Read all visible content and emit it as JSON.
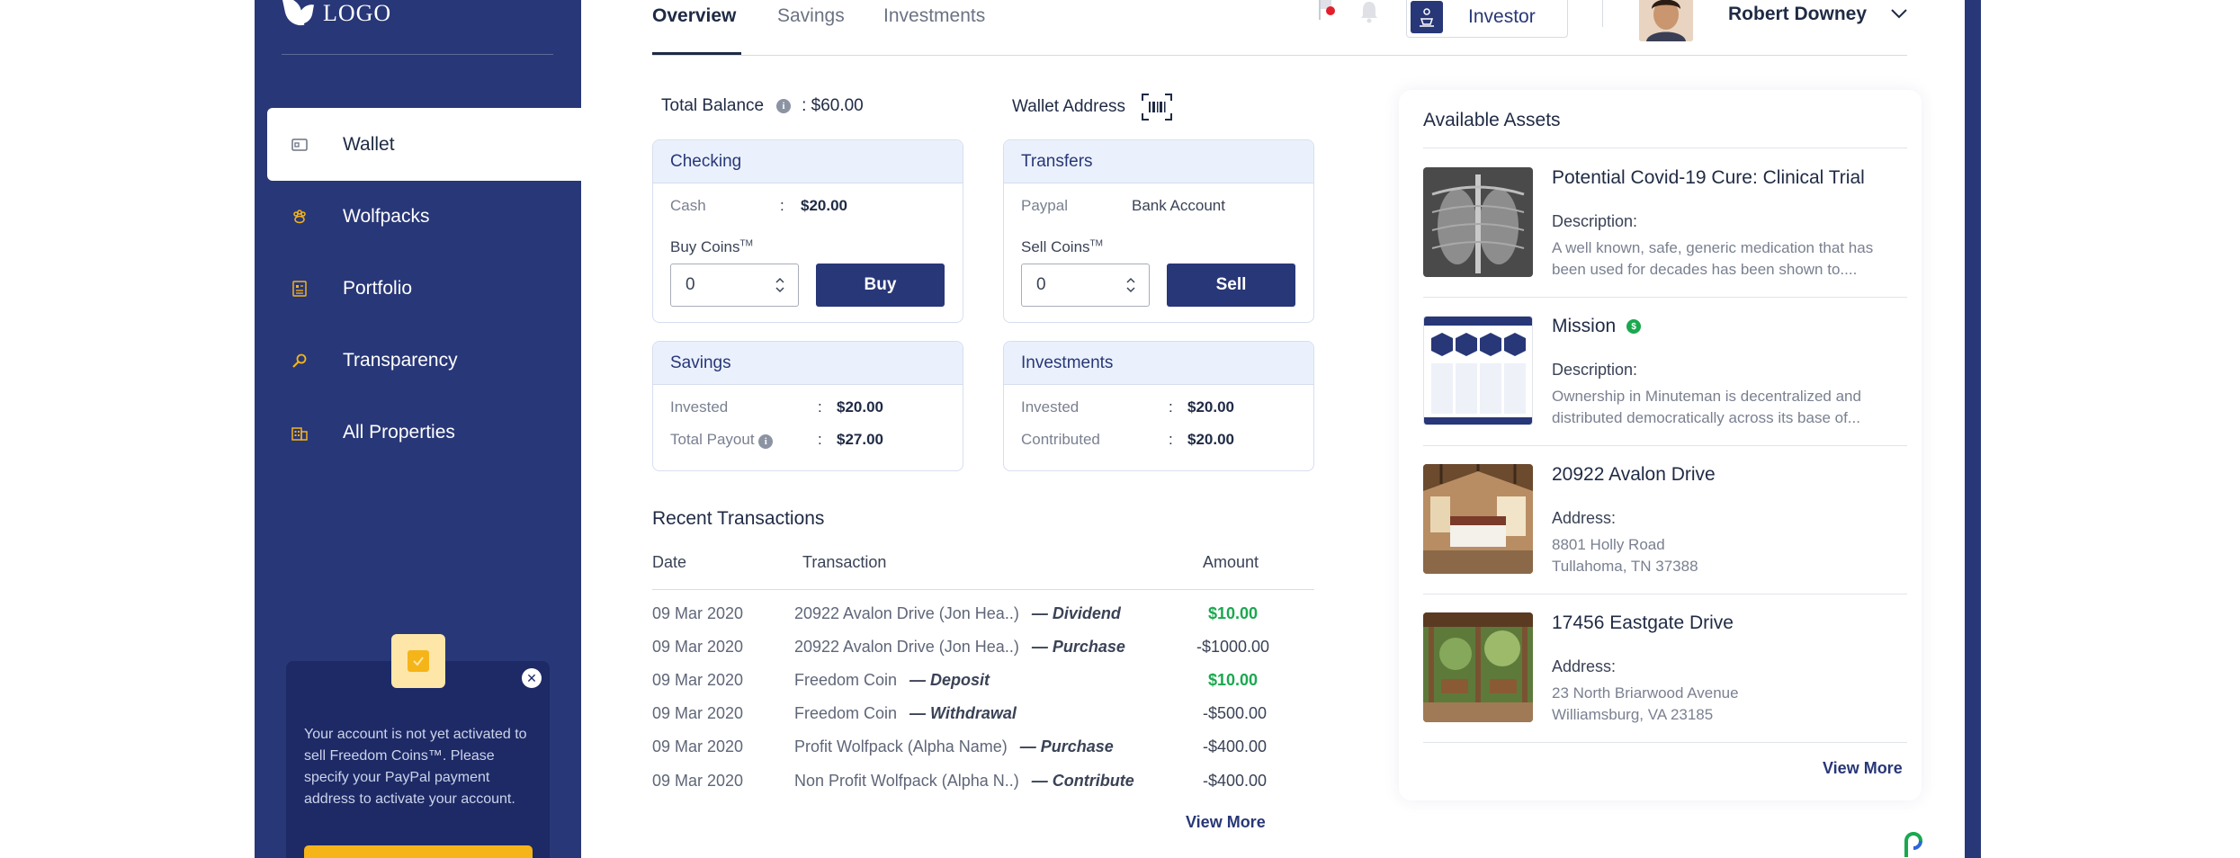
{
  "sidebar": {
    "logo_text": "LOGO",
    "items": [
      {
        "label": "Wallet"
      },
      {
        "label": "Wolfpacks"
      },
      {
        "label": "Portfolio"
      },
      {
        "label": "Transparency"
      },
      {
        "label": "All Properties"
      }
    ],
    "popup": {
      "text": "Your account is not yet activated to sell Freedom Coins™. Please specify your PayPal payment address to activate your account.",
      "close_icon": "close-icon"
    }
  },
  "tabs": [
    "Overview",
    "Savings",
    "Investments"
  ],
  "header": {
    "role_label": "Investor",
    "user_name": "Robert Downey"
  },
  "balance": {
    "label": "Total Balance",
    "value": ": $60.00",
    "wallet_label": "Wallet Address"
  },
  "checking": {
    "title": "Checking",
    "cash_label": "Cash",
    "cash_value": "$20.00",
    "buy_label": "Buy Coins",
    "tm": "TM",
    "input_value": "0",
    "button": "Buy"
  },
  "transfers": {
    "title": "Transfers",
    "paypal": "Paypal",
    "bank": "Bank Account",
    "sell_label": "Sell Coins",
    "tm": "TM",
    "input_value": "0",
    "button": "Sell"
  },
  "savings": {
    "title": "Savings",
    "invested_label": "Invested",
    "invested_value": "$20.00",
    "payout_label": "Total Payout",
    "payout_value": "$27.00"
  },
  "investments": {
    "title": "Investments",
    "invested_label": "Invested",
    "invested_value": "$20.00",
    "contributed_label": "Contributed",
    "contributed_value": "$20.00"
  },
  "transactions": {
    "title": "Recent Transactions",
    "headers": {
      "date": "Date",
      "transaction": "Transaction",
      "amount": "Amount"
    },
    "rows": [
      {
        "date": "09 Mar 2020",
        "name": "20922 Avalon Drive  (Jon Hea..)",
        "type": "— Dividend",
        "amount": "$10.00",
        "positive": true
      },
      {
        "date": "09 Mar 2020",
        "name": "20922 Avalon Drive  (Jon Hea..)",
        "type": "— Purchase",
        "amount": "-$1000.00",
        "positive": false
      },
      {
        "date": "09 Mar 2020",
        "name": "Freedom Coin",
        "type": "— Deposit",
        "amount": "$10.00",
        "positive": true
      },
      {
        "date": "09 Mar 2020",
        "name": "Freedom Coin",
        "type": "— Withdrawal",
        "amount": "-$500.00",
        "positive": false
      },
      {
        "date": "09 Mar 2020",
        "name": "Profit Wolfpack (Alpha Name)",
        "type": "— Purchase",
        "amount": "-$400.00",
        "positive": false
      },
      {
        "date": "09 Mar 2020",
        "name": "Non Profit Wolfpack (Alpha N..)",
        "type": "— Contribute",
        "amount": "-$400.00",
        "positive": false
      }
    ],
    "view_more": "View More"
  },
  "assets": {
    "title": "Available Assets",
    "items": [
      {
        "title": "Potential Covid-19 Cure: Clinical Trial",
        "label": "Description:",
        "desc": "A well known, safe, generic medication that has been used for decades has been shown to...."
      },
      {
        "title": "Mission",
        "label": "Description:",
        "desc": "Ownership in Minuteman is decentralized and distributed democratically across its base of..."
      },
      {
        "title": "20922 Avalon Drive",
        "label": "Address:",
        "desc": "8801 Holly Road\nTullahoma, TN 37388"
      },
      {
        "title": "17456 Eastgate Drive",
        "label": "Address:",
        "desc": "23 North Briarwood Avenue\nWilliamsburg, VA 23185"
      }
    ],
    "view_more": "View More"
  },
  "colors": {
    "sidebar": "#283777",
    "accent": "#f5b418",
    "positive": "#1aa84f",
    "card_head": "#eaf1fd"
  }
}
